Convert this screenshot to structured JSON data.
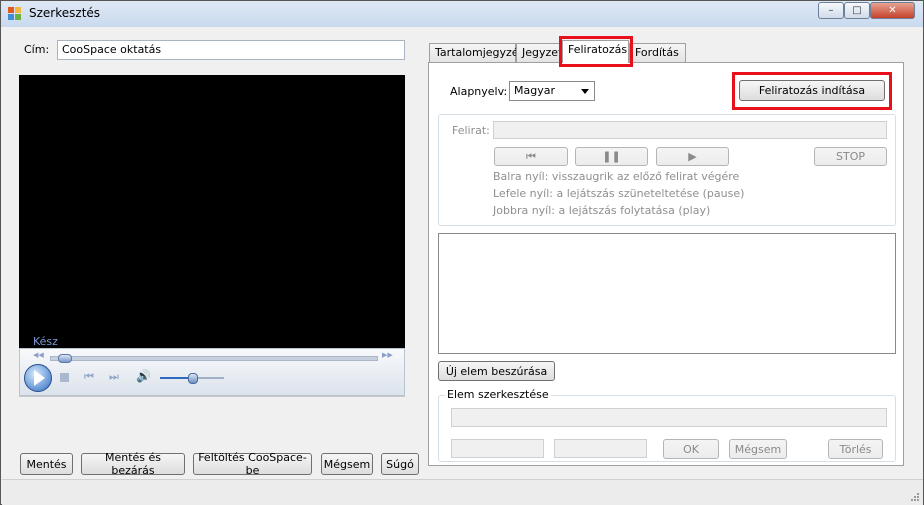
{
  "window": {
    "title": "Szerkesztés",
    "minimize_glyph": "–",
    "maximize_glyph": "□",
    "close_glyph": "✕"
  },
  "form": {
    "title_label": "Cím:",
    "title_value": "CooSpace oktatás"
  },
  "player": {
    "status": "Kész",
    "progress_fraction": 0.02,
    "volume_fraction": 0.5
  },
  "tabs": [
    {
      "label": "Tartalomjegyzék"
    },
    {
      "label": "Jegyzet"
    },
    {
      "label": "Feliratozás"
    },
    {
      "label": "Fordítás"
    }
  ],
  "subtitle": {
    "base_language_label": "Alapnyelv:",
    "base_language_value": "Magyar",
    "start_button": "Feliratozás indítása",
    "caption_label": "Felirat:",
    "stop_button": "STOP",
    "hint_left": "Balra nyíl: visszaugrik az előző felirat végére",
    "hint_down": "Lefele nyíl: a lejátszás szüneteltetése (pause)",
    "hint_right": "Jobbra nyíl: a lejátszás folytatása (play)",
    "insert_button": "Új elem beszúrása",
    "edit_group_label": "Elem szerkesztése",
    "ok_button": "OK",
    "cancel_button": "Mégsem",
    "delete_button": "Törlés"
  },
  "bottom_buttons": {
    "save": "Mentés",
    "save_close": "Mentés és bezárás",
    "upload": "Feltöltés CooSpace-be",
    "cancel": "Mégsem",
    "help": "Súgó"
  },
  "colors": {
    "highlight": "#e8101a",
    "video_bg": "#000000",
    "status_text": "#7e98d6"
  }
}
